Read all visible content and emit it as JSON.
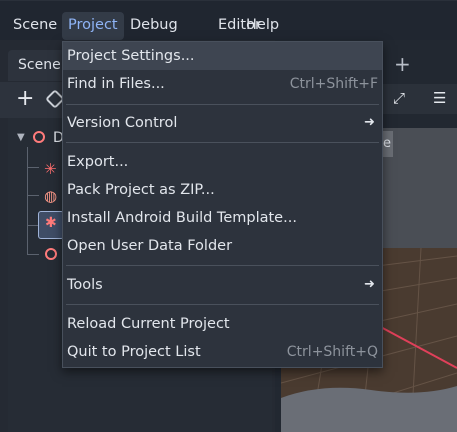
{
  "menubar": {
    "items": [
      {
        "label": "Scene"
      },
      {
        "label": "Project"
      },
      {
        "label": "Debug"
      },
      {
        "label": "Editor"
      },
      {
        "label": "Help"
      }
    ],
    "active_index": 1,
    "active_color": "#8fb4f6"
  },
  "scene_dock": {
    "tab_label": "Scene",
    "root_node_initial": "D",
    "add_tab_symbol": "+",
    "add_node_symbol": "+"
  },
  "viewport": {
    "partial_label": "e"
  },
  "project_menu": {
    "items": [
      {
        "label": "Project Settings...",
        "shortcut": "",
        "submenu": false,
        "hovered": true
      },
      {
        "label": "Find in Files...",
        "shortcut": "Ctrl+Shift+F",
        "submenu": false
      },
      {
        "label": "Version Control",
        "shortcut": "",
        "submenu": true
      },
      {
        "label": "Export...",
        "shortcut": "",
        "submenu": false
      },
      {
        "label": "Pack Project as ZIP...",
        "shortcut": "",
        "submenu": false
      },
      {
        "label": "Install Android Build Template...",
        "shortcut": "",
        "submenu": false
      },
      {
        "label": "Open User Data Folder",
        "shortcut": "",
        "submenu": false
      },
      {
        "label": "Tools",
        "shortcut": "",
        "submenu": true
      },
      {
        "label": "Reload Current Project",
        "shortcut": "",
        "submenu": false
      },
      {
        "label": "Quit to Project List",
        "shortcut": "Ctrl+Shift+Q",
        "submenu": false
      }
    ],
    "submenu_arrow": "➜"
  },
  "colors": {
    "menubar_bg": "#202630",
    "menu_bg": "#2d333d",
    "node_accent": "#ff7b7b",
    "axis_red": "#e0405a"
  }
}
